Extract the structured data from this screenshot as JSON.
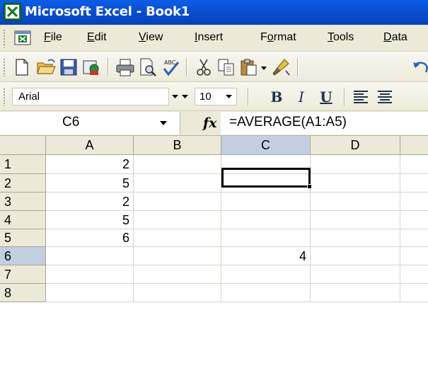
{
  "window": {
    "title": "Microsoft Excel - Book1",
    "app_icon": "excel-icon"
  },
  "menu": {
    "items": [
      {
        "label": "File",
        "underline": "F",
        "rest": "ile"
      },
      {
        "label": "Edit",
        "underline": "E",
        "rest": "dit"
      },
      {
        "label": "View",
        "underline": "V",
        "rest": "iew"
      },
      {
        "label": "Insert",
        "underline": "I",
        "rest": "nsert"
      },
      {
        "label": "Format",
        "pre": "F",
        "underline": "o",
        "rest": "rmat"
      },
      {
        "label": "Tools",
        "underline": "T",
        "rest": "ools"
      },
      {
        "label": "Data",
        "underline": "D",
        "rest": "ata"
      }
    ]
  },
  "toolbar": {
    "icons": [
      "new-icon",
      "open-icon",
      "save-icon",
      "permission-icon",
      "print-icon",
      "print-preview-icon",
      "spelling-icon",
      "cut-icon",
      "copy-icon",
      "paste-icon",
      "format-painter-icon",
      "undo-icon"
    ]
  },
  "format": {
    "font_name": "Arial",
    "font_size": "10",
    "bold": "B",
    "italic": "I",
    "underline": "U"
  },
  "formula_bar": {
    "name_box": "C6",
    "fx": "fx",
    "formula": "=AVERAGE(A1:A5)"
  },
  "sheet": {
    "columns": [
      "A",
      "B",
      "C",
      "D"
    ],
    "rows": [
      "1",
      "2",
      "3",
      "4",
      "5",
      "6",
      "7",
      "8"
    ],
    "active_column": "C",
    "active_row": "6",
    "cells": {
      "A1": "2",
      "A2": "5",
      "A3": "2",
      "A4": "5",
      "A5": "6",
      "C6": "4"
    }
  },
  "colors": {
    "title_bar": "#0a4fd0",
    "chrome": "#ece9d8",
    "header_active": "#c2cfe0",
    "excel_green": "#1d7a2c"
  }
}
